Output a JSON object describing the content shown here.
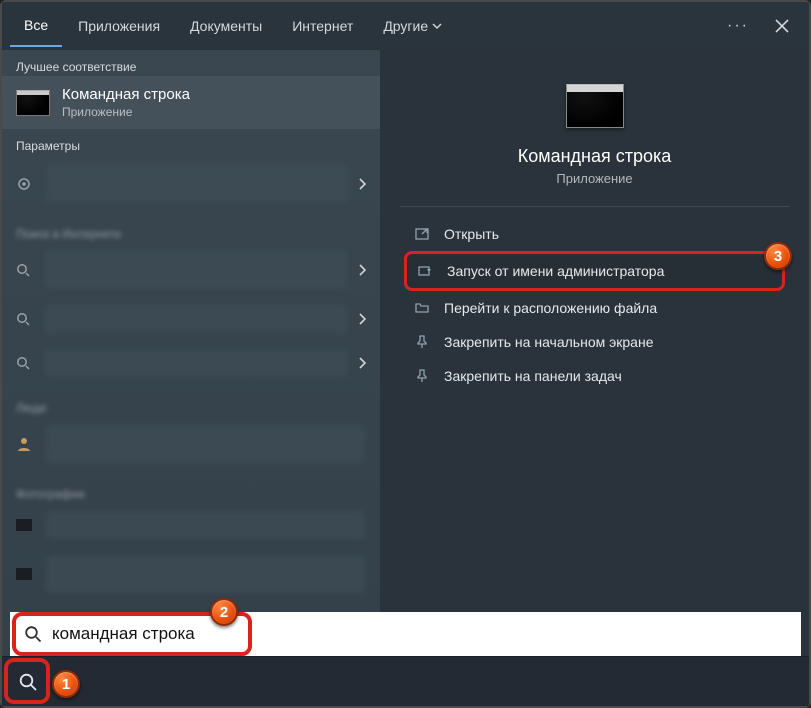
{
  "tabs": {
    "all": "Все",
    "apps": "Приложения",
    "docs": "Документы",
    "web": "Интернет",
    "more": "Другие"
  },
  "left": {
    "best_match_header": "Лучшее соответствие",
    "best_match_title": "Командная строка",
    "best_match_sub": "Приложение",
    "params_header": "Параметры"
  },
  "preview": {
    "title": "Командная строка",
    "sub": "Приложение"
  },
  "actions": {
    "open": "Открыть",
    "run_admin": "Запуск от имени администратора",
    "open_location": "Перейти к расположению файла",
    "pin_start": "Закрепить на начальном экране",
    "pin_taskbar": "Закрепить на панели задач"
  },
  "search": {
    "value": "командная строка"
  },
  "callouts": {
    "c1": "1",
    "c2": "2",
    "c3": "3"
  }
}
